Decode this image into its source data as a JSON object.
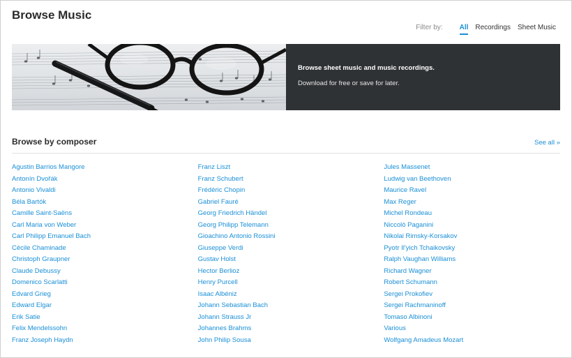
{
  "page": {
    "title": "Browse Music"
  },
  "filter": {
    "label": "Filter by:",
    "options": [
      "All",
      "Recordings",
      "Sheet Music"
    ],
    "selected": "All"
  },
  "hero": {
    "image_alt": "sheet music with glasses and pen",
    "title": "Browse sheet music and music recordings.",
    "subtitle": "Download for free or save for later."
  },
  "section": {
    "title": "Browse by composer",
    "see_all": "See all »"
  },
  "composers": {
    "col1": [
      "Agustin Barrios Mangore",
      "Antonín Dvořák",
      "Antonio Vivaldi",
      "Béla Bartók",
      "Camille Saint-Saëns",
      "Carl Maria von Weber",
      "Carl Philipp Emanuel Bach",
      "Cécile Chaminade",
      "Christoph Graupner",
      "Claude Debussy",
      "Domenico Scarlatti",
      "Edvard Grieg",
      "Edward Elgar",
      "Erik Satie",
      "Felix Mendelssohn",
      "Franz Joseph Haydn"
    ],
    "col2": [
      "Franz Liszt",
      "Franz Schubert",
      "Frédéric Chopin",
      "Gabriel Fauré",
      "Georg Friedrich Händel",
      "Georg Philipp Telemann",
      "Gioachino Antonio Rossini",
      "Giuseppe Verdi",
      "Gustav Holst",
      "Hector Berlioz",
      "Henry Purcell",
      "Isaac Albéniz",
      "Johann Sebastian Bach",
      "Johann Strauss Jr",
      "Johannes Brahms",
      "John Philip Sousa"
    ],
    "col3": [
      "Jules Massenet",
      "Ludwig van Beethoven",
      "Maurice Ravel",
      "Max Reger",
      "Michel Rondeau",
      "Niccolò Paganini",
      "Nikolai Rimsky-Korsakov",
      "Pyotr Il'yich Tchaikovsky",
      "Ralph Vaughan Williams",
      "Richard Wagner",
      "Robert Schumann",
      "Sergei Prokofiev",
      "Sergei Rachmaninoff",
      "Tomaso Albinoni",
      "Various",
      "Wolfgang Amadeus Mozart"
    ]
  },
  "colors": {
    "accent": "#1a8fd6",
    "hero_panel": "#2f3235"
  }
}
